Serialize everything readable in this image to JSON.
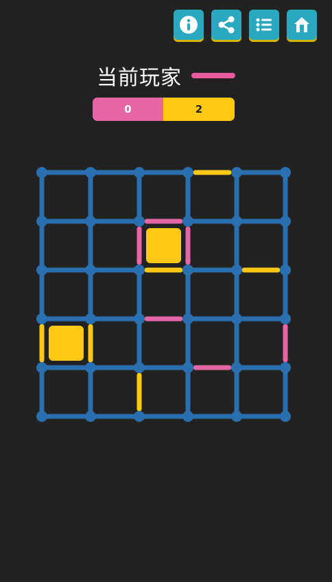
{
  "toolbar": {
    "buttons": [
      {
        "name": "info-button",
        "icon": "info-icon"
      },
      {
        "name": "share-button",
        "icon": "share-icon"
      },
      {
        "name": "list-button",
        "icon": "list-icon"
      },
      {
        "name": "home-button",
        "icon": "home-icon"
      }
    ],
    "icon_color": "#ffffff",
    "button_color": "#2aa8bf"
  },
  "current_player": {
    "label": "当前玩家",
    "color": "#e85aa0"
  },
  "score": {
    "player1": "0",
    "player2": "2",
    "player1_color": "#e565a5",
    "player2_color": "#ffc812"
  },
  "board": {
    "rows": 5,
    "cols": 5,
    "colors": {
      "line": "#2a6fb0",
      "dot": "#2a6fb0",
      "pink": "#e565a5",
      "yellow": "#ffc812"
    },
    "horizontal_edges": [
      [
        null,
        null,
        null,
        "yellow",
        null
      ],
      [
        null,
        null,
        "pink",
        null,
        null
      ],
      [
        null,
        null,
        "yellow",
        null,
        "yellow"
      ],
      [
        null,
        null,
        "pink",
        null,
        null
      ],
      [
        null,
        null,
        null,
        "pink",
        null
      ],
      [
        null,
        null,
        null,
        null,
        null
      ]
    ],
    "vertical_edges": [
      [
        null,
        null,
        null,
        null,
        null,
        null
      ],
      [
        null,
        null,
        "pink",
        "pink",
        null,
        null
      ],
      [
        null,
        null,
        null,
        null,
        null,
        null
      ],
      [
        "yellow",
        "yellow",
        null,
        null,
        null,
        "pink"
      ],
      [
        null,
        null,
        "yellow",
        null,
        null,
        null
      ]
    ],
    "boxes": [
      [
        null,
        null,
        null,
        null,
        null
      ],
      [
        null,
        null,
        "yellow",
        null,
        null
      ],
      [
        null,
        null,
        null,
        null,
        null
      ],
      [
        "yellow",
        null,
        null,
        null,
        null
      ],
      [
        null,
        null,
        null,
        null,
        null
      ]
    ]
  }
}
